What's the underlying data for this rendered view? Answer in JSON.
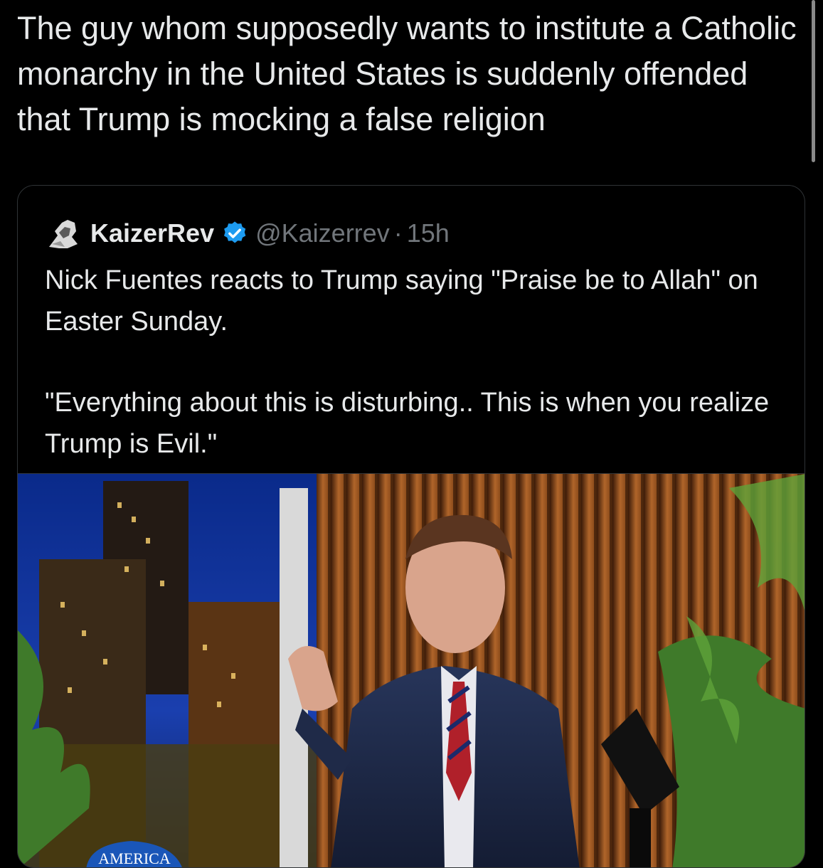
{
  "tweet": {
    "text": "The guy whom supposedly wants to institute a Catholic monarchy in the United States is suddenly offended that Trump is mocking a false religion"
  },
  "quote": {
    "display_name": "KaizerRev",
    "handle": "@Kaizerrev",
    "separator": "·",
    "timestamp": "15h",
    "paragraph1": "Nick Fuentes reacts to Trump saying \"Praise be to Allah\" on Easter Sunday.",
    "paragraph2": "\"Everything about this is disturbing.. This is when you realize Trump is Evil.\"",
    "verified_color": "#1d9bf0",
    "media": {
      "kind": "video-still",
      "sign_text": "AMERICA"
    }
  },
  "icons": {
    "avatar": "profile-avatar-icon",
    "verified": "verified-badge-icon"
  }
}
